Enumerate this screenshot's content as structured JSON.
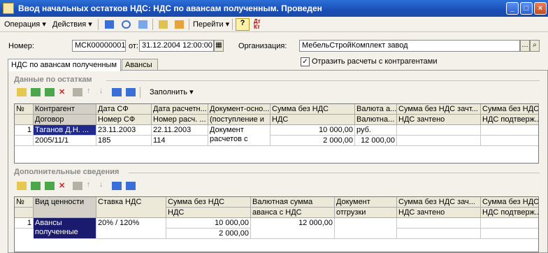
{
  "window": {
    "title": "Ввод начальных остатков НДС: НДС по авансам полученным. Проведен"
  },
  "toolbar": {
    "operation": "Операция",
    "actions": "Действия",
    "go": "Перейти",
    "help": "?"
  },
  "header": {
    "number_label": "Номер:",
    "number_value": "МСК00000001",
    "date_label": "от:",
    "date_value": "31.12.2004 12:00:00",
    "org_label": "Организация:",
    "org_value": "МебельСтройКомплект завод",
    "show_settlements": "Отразить расчеты с контрагентами"
  },
  "tabs": [
    "НДС по авансам полученным",
    "Авансы"
  ],
  "section1": {
    "title": "Данные по остаткам",
    "fill_button": "Заполнить",
    "headers_top": [
      "№",
      "Контрагент",
      "Дата СФ",
      "Дата расчетн...",
      "Документ-осно...",
      "Сумма без НДС",
      "Валюта а...",
      "Сумма без НДС зачт...",
      "Сумма без НДС"
    ],
    "headers_bottom": [
      "",
      "Договор",
      "Номер СФ",
      "Номер расч. ...",
      "(поступление и",
      "НДС",
      "Валютна...",
      "НДС зачтено",
      "НДС подтверж..."
    ],
    "row": {
      "num": "1",
      "counterparty": "Таганов Д.Н. ...",
      "date_sf": "23.11.2003",
      "date_calc": "22.11.2003",
      "doc_line1": "Документ",
      "doc_line2": "расчетов с",
      "sum": "10 000,00",
      "currency": "руб.",
      "contract": "2005/11/1",
      "num_sf": "185",
      "num_calc": "114",
      "vat": "2 000,00",
      "cur_sum": "12 000,00"
    }
  },
  "section2": {
    "title": "Дополнительные сведения",
    "headers_top": [
      "№",
      "Вид ценности",
      "Ставка НДС",
      "Сумма без НДС",
      "Валютная сумма",
      "Документ",
      "Сумма без НДС зач...",
      "Сумма без НДС"
    ],
    "headers_bottom": [
      "",
      "",
      "",
      "НДС",
      "аванса с НДС",
      "отгрузки",
      "НДС зачтено",
      "НДС подтверж..."
    ],
    "row": {
      "num": "1",
      "kind_line1": "Авансы",
      "kind_line2": "полученные",
      "rate": "20% / 120%",
      "sum": "10 000,00",
      "cur_sum": "12 000,00",
      "vat": "2 000,00"
    }
  },
  "colors": {
    "title_bar": "#1a4fb8",
    "selection": "#1f2a8c",
    "highlight_header": "#d4d0c8"
  }
}
